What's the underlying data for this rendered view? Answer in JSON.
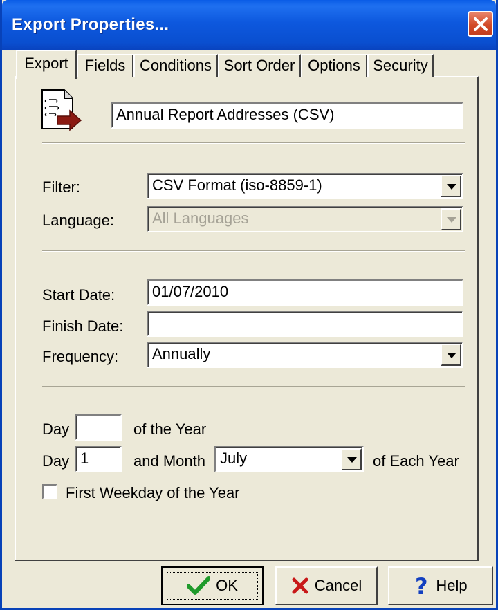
{
  "window": {
    "title": "Export Properties..."
  },
  "tabs": [
    {
      "label": "Export"
    },
    {
      "label": "Fields"
    },
    {
      "label": "Conditions"
    },
    {
      "label": "Sort Order"
    },
    {
      "label": "Options"
    },
    {
      "label": "Security"
    }
  ],
  "export_name": {
    "value": "Annual Report Addresses (CSV)"
  },
  "filter": {
    "label": "Filter:",
    "value": "CSV Format (iso-8859-1)"
  },
  "language": {
    "label": "Language:",
    "value": "All Languages"
  },
  "start_date": {
    "label": "Start Date:",
    "value": "01/07/2010"
  },
  "finish_date": {
    "label": "Finish Date:",
    "value": ""
  },
  "frequency": {
    "label": "Frequency:",
    "value": "Annually"
  },
  "schedule": {
    "day_label_1": "Day",
    "day_of_year_value": "",
    "of_the_year": "of the Year",
    "day_label_2": "Day",
    "day_of_month_value": "1",
    "and_month": "and Month",
    "month_value": "July",
    "of_each_year": "of Each Year",
    "first_weekday_label": "First Weekday of the Year",
    "first_weekday_checked": false
  },
  "buttons": {
    "ok": "OK",
    "cancel": "Cancel",
    "help": "Help"
  },
  "icons": {
    "close": "close-icon",
    "document": "export-document-icon",
    "ok": "checkmark-icon",
    "cancel": "x-icon",
    "help": "question-mark-icon"
  },
  "colors": {
    "titlebar": "#0a5ce6",
    "close": "#d24a28",
    "window_bg": "#ece9d8"
  }
}
